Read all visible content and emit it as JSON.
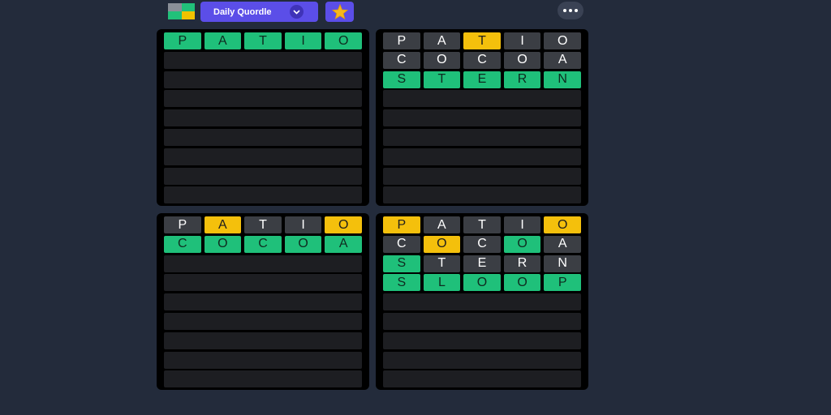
{
  "header": {
    "mode_label": "Daily Quordle",
    "chevron_icon": "chevron-down-icon",
    "star_icon": "star-icon",
    "more_icon": "more-options-icon",
    "logo_colors": [
      "#8a8f98",
      "#21c07a",
      "#21c07a",
      "#f2c200"
    ]
  },
  "colors": {
    "correct": "#1fc07a",
    "present": "#f4c00c",
    "absent": "#3b3e44",
    "empty": "#1d1e22"
  },
  "boards": [
    {
      "rows": [
        {
          "letters": [
            "P",
            "A",
            "T",
            "I",
            "O"
          ],
          "states": [
            "correct",
            "correct",
            "correct",
            "correct",
            "correct"
          ]
        }
      ],
      "total_rows": 9
    },
    {
      "rows": [
        {
          "letters": [
            "P",
            "A",
            "T",
            "I",
            "O"
          ],
          "states": [
            "absent",
            "absent",
            "present",
            "absent",
            "absent"
          ]
        },
        {
          "letters": [
            "C",
            "O",
            "C",
            "O",
            "A"
          ],
          "states": [
            "absent",
            "absent",
            "absent",
            "absent",
            "absent"
          ]
        },
        {
          "letters": [
            "S",
            "T",
            "E",
            "R",
            "N"
          ],
          "states": [
            "correct",
            "correct",
            "correct",
            "correct",
            "correct"
          ]
        }
      ],
      "total_rows": 9
    },
    {
      "rows": [
        {
          "letters": [
            "P",
            "A",
            "T",
            "I",
            "O"
          ],
          "states": [
            "absent",
            "present",
            "absent",
            "absent",
            "present"
          ]
        },
        {
          "letters": [
            "C",
            "O",
            "C",
            "O",
            "A"
          ],
          "states": [
            "correct",
            "correct",
            "correct",
            "correct",
            "correct"
          ]
        }
      ],
      "total_rows": 9
    },
    {
      "rows": [
        {
          "letters": [
            "P",
            "A",
            "T",
            "I",
            "O"
          ],
          "states": [
            "present",
            "absent",
            "absent",
            "absent",
            "present"
          ]
        },
        {
          "letters": [
            "C",
            "O",
            "C",
            "O",
            "A"
          ],
          "states": [
            "absent",
            "present",
            "absent",
            "correct",
            "absent"
          ]
        },
        {
          "letters": [
            "S",
            "T",
            "E",
            "R",
            "N"
          ],
          "states": [
            "correct",
            "absent",
            "absent",
            "absent",
            "absent"
          ]
        },
        {
          "letters": [
            "S",
            "L",
            "O",
            "O",
            "P"
          ],
          "states": [
            "correct",
            "correct",
            "correct",
            "correct",
            "correct"
          ]
        }
      ],
      "total_rows": 9
    }
  ]
}
